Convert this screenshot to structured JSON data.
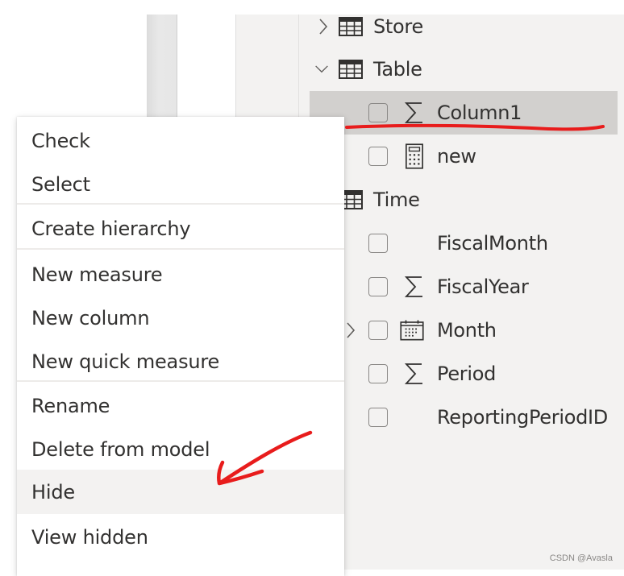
{
  "fields_pane": {
    "tables": [
      {
        "name": "Store",
        "expanded": false
      },
      {
        "name": "Table",
        "expanded": true
      },
      {
        "name": "Time",
        "expanded": true
      }
    ],
    "items": [
      {
        "table": "Table",
        "name": "Column1",
        "icon": "sigma-icon",
        "selected": true,
        "checked": false
      },
      {
        "table": "Table",
        "name": "new",
        "icon": "calculator-icon",
        "selected": false,
        "checked": false
      },
      {
        "table": "Time",
        "name": "FiscalMonth",
        "icon": "",
        "selected": false,
        "checked": false
      },
      {
        "table": "Time",
        "name": "FiscalYear",
        "icon": "sigma-icon",
        "selected": false,
        "checked": false
      },
      {
        "table": "Time",
        "name": "Month",
        "icon": "calendar-icon",
        "selected": false,
        "checked": false,
        "expandable": true
      },
      {
        "table": "Time",
        "name": "Period",
        "icon": "sigma-icon",
        "selected": false,
        "checked": false
      },
      {
        "table": "Time",
        "name": "ReportingPeriodID",
        "icon": "",
        "selected": false,
        "checked": false
      }
    ]
  },
  "context_menu": {
    "groups": [
      [
        "Check",
        "Select"
      ],
      [
        "Create hierarchy"
      ],
      [
        "New measure",
        "New column",
        "New quick measure"
      ],
      [
        "Rename",
        "Delete from model",
        "Hide",
        "View hidden"
      ]
    ],
    "hovered_item": "Hide"
  },
  "annotations": {
    "underline_color": "#e81c1c",
    "arrow_color": "#e81c1c"
  },
  "watermark": "CSDN @Avasla"
}
